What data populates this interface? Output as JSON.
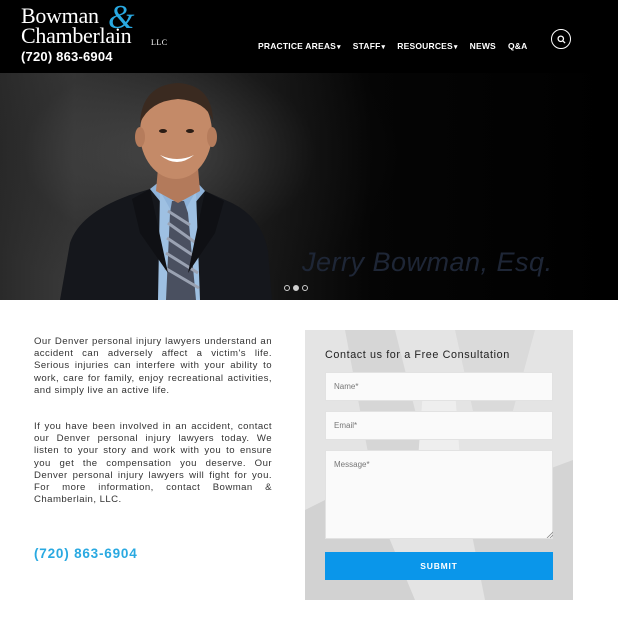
{
  "header": {
    "logo": {
      "line1": "Bowman",
      "ampersand": "&",
      "line2": "Chamberlain",
      "suffix": "LLC",
      "phone": "(720) 863-6904"
    },
    "nav": [
      {
        "label": "PRACTICE AREAS",
        "dropdown": true
      },
      {
        "label": "STAFF",
        "dropdown": true
      },
      {
        "label": "RESOURCES",
        "dropdown": true
      },
      {
        "label": "NEWS",
        "dropdown": false
      },
      {
        "label": "Q&A",
        "dropdown": false
      }
    ],
    "search_icon": "search-icon"
  },
  "hero": {
    "caption": "Jerry Bowman, Esq.",
    "slide_count": 3,
    "active_slide": 2
  },
  "intro": {
    "paragraphs": [
      "Our Denver personal injury lawyers understand an accident can adversely affect a victim's life. Serious injuries can interfere with your ability to work, care for family, enjoy recreational activities, and simply live an active life.",
      "If you have been involved in an accident, contact our Denver personal injury lawyers today. We listen to your story and work with you to ensure you get the compensation you deserve. Our Denver personal injury lawyers will fight for you. For more information, contact Bowman & Chamberlain, LLC."
    ],
    "phone": "(720) 863-6904"
  },
  "form": {
    "title": "Contact us for a Free Consultation",
    "name_placeholder": "Name*",
    "email_placeholder": "Email*",
    "message_placeholder": "Message*",
    "submit_label": "SUBMIT"
  },
  "colors": {
    "accent": "#29a9e1",
    "button": "#0a96ea",
    "header_bg": "#000000"
  }
}
